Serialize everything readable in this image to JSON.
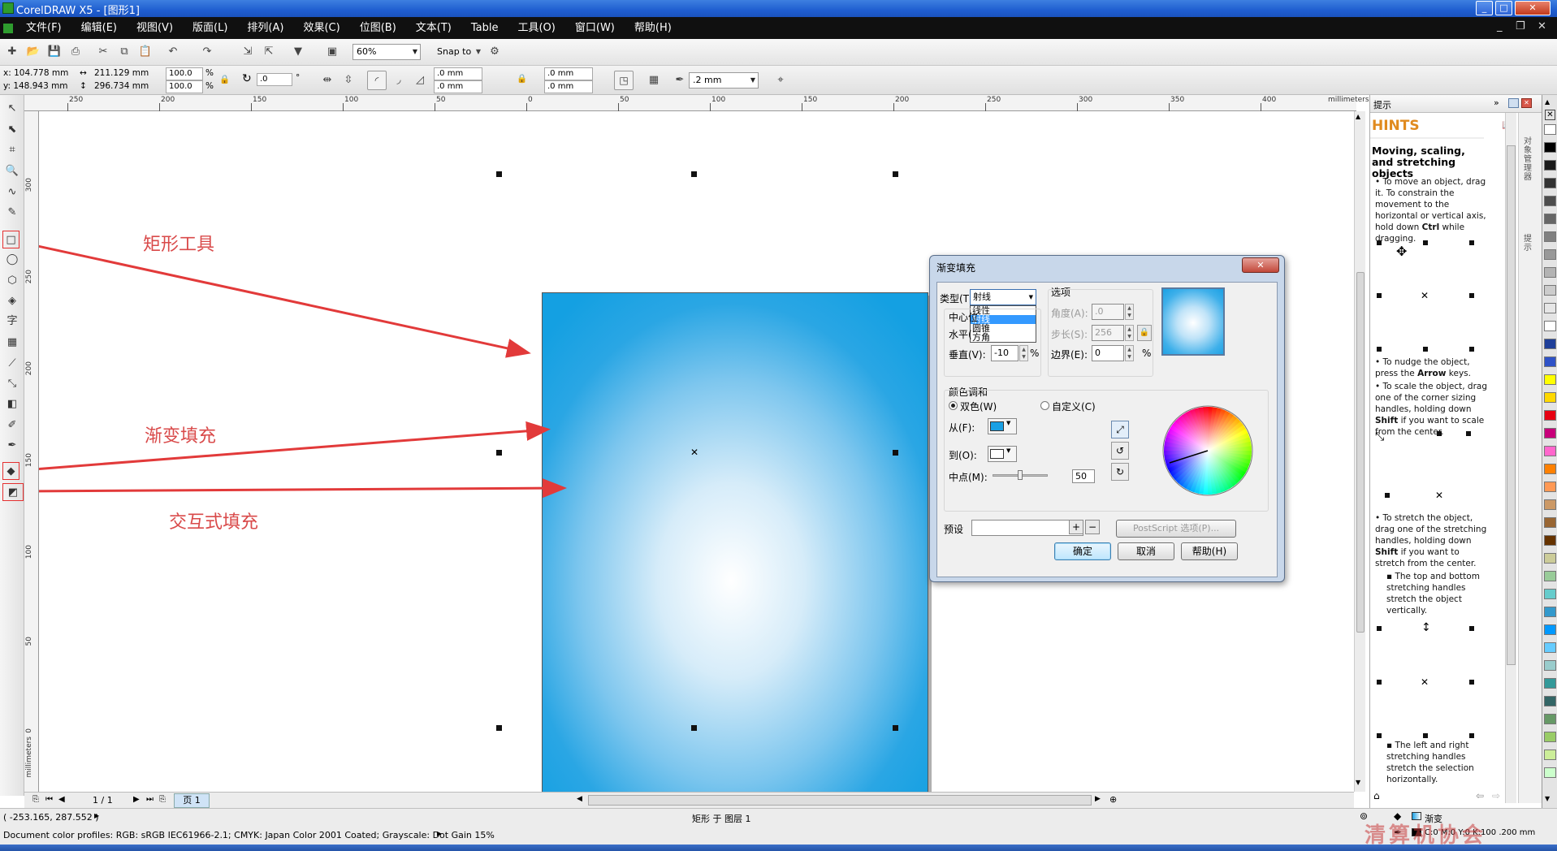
{
  "window": {
    "title": "CorelDRAW X5 - [图形1]"
  },
  "menu": [
    "文件(F)",
    "编辑(E)",
    "视图(V)",
    "版面(L)",
    "排列(A)",
    "效果(C)",
    "位图(B)",
    "文本(T)",
    "Table",
    "工具(O)",
    "窗口(W)",
    "帮助(H)"
  ],
  "std_toolbar": {
    "zoom": "60%",
    "snap": "Snap to"
  },
  "property_bar": {
    "x": "x: 104.778 mm",
    "y": "y: 148.943 mm",
    "width": "211.129 mm",
    "height": "296.734 mm",
    "scale_w": "100.0",
    "scale_h": "100.0",
    "percent": "%",
    "rotation": ".0",
    "degree": "°",
    "corner1": ".0 mm",
    "corner2": ".0 mm",
    "corner3": ".0 mm",
    "corner4": ".0 mm",
    "outline": ".2 mm"
  },
  "ruler": {
    "h_ticks": [
      "250",
      "200",
      "150",
      "100",
      "50",
      "0",
      "50",
      "100",
      "150",
      "200",
      "250",
      "300",
      "350",
      "400"
    ],
    "h_unit": "millimeters",
    "v_ticks": [
      "300",
      "250",
      "200",
      "150",
      "100",
      "50",
      "0"
    ],
    "v_unit": "millimeters"
  },
  "annotations": {
    "rect_tool": "矩形工具",
    "gradient_fill": "渐变填充",
    "interactive_fill": "交互式填充"
  },
  "dialog": {
    "title": "渐变填充",
    "type_label": "类型(T):",
    "type_value": "射线",
    "type_options": [
      "线性",
      "射线",
      "圆锥",
      "方角"
    ],
    "center_label": "中心位",
    "horiz_label": "水平(",
    "vert_label": "垂直(V):",
    "vert_value": "-10",
    "percent": "%",
    "options_label": "选项",
    "angle_label": "角度(A):",
    "angle_value": ".0",
    "steps_label": "步长(S):",
    "steps_value": "256",
    "border_label": "边界(E):",
    "border_value": "0",
    "blend_label": "颜色调和",
    "two_color": "双色(W)",
    "custom": "自定义(C)",
    "from_label": "从(F):",
    "to_label": "到(O):",
    "mid_label": "中点(M):",
    "mid_value": "50",
    "preset_label": "预设",
    "postscript_btn": "PostScript 选项(P)...",
    "ok": "确定",
    "cancel": "取消",
    "help": "帮助(H)",
    "from_color": "#1aa0e4",
    "to_color": "#ffffff"
  },
  "hints": {
    "tab": "提示",
    "title": "HINTS",
    "heading": "Moving, scaling, and stretching objects",
    "p1a": "To move an object, drag it. To constrain the movement to the horizontal or vertical axis, hold down ",
    "p1b": "Ctrl",
    "p1c": " while dragging.",
    "p2a": "To nudge the object, press the ",
    "p2b": "Arrow",
    "p2c": " keys.",
    "p3a": "To scale the object, drag one of the corner sizing handles, holding down ",
    "p3b": "Shift",
    "p3c": " if you want to scale from the center.",
    "p4a": "To stretch the object, drag one of the stretching handles, holding down ",
    "p4b": "Shift",
    "p4c": " if you want to stretch from the center.",
    "p5": "The top and bottom stretching handles stretch the object vertically.",
    "p6": "The left and right stretching handles stretch the selection horizontally.",
    "side_tabs": "对象管理器",
    "side_tab2": "提示"
  },
  "docnav": {
    "page_count": "1 / 1",
    "page_tab": "页 1"
  },
  "status": {
    "coords": "( -253.165, 287.552 )",
    "object": "矩形 于 图层 1",
    "profiles": "Document color profiles: RGB: sRGB IEC61966-2.1; CMYK: Japan Color 2001 Coated; Grayscale: Dot Gain 15%",
    "fill_name": "渐变",
    "outline_info": "C:0 M:0 Y:0 K:100 .200 mm",
    "watermark": "清算机协会"
  },
  "palette": [
    "#ffffff",
    "#000000",
    "#1a1a1a",
    "#333333",
    "#4d4d4d",
    "#666666",
    "#808080",
    "#999999",
    "#b3b3b3",
    "#cccccc",
    "#e6e6e6",
    "#ffffff",
    "#1f3f99",
    "#2f52c7",
    "#ffff00",
    "#ffd800",
    "#e60012",
    "#c8007a",
    "#ff66cc",
    "#ff8000",
    "#ff9955",
    "#cc9966",
    "#996633",
    "#663300",
    "#cccc99",
    "#99cc99",
    "#66cccc",
    "#3399cc",
    "#0099ff",
    "#66ccff",
    "#99cccc",
    "#339999",
    "#336666",
    "#669966",
    "#99cc66",
    "#ccee99",
    "#ccffcc"
  ]
}
